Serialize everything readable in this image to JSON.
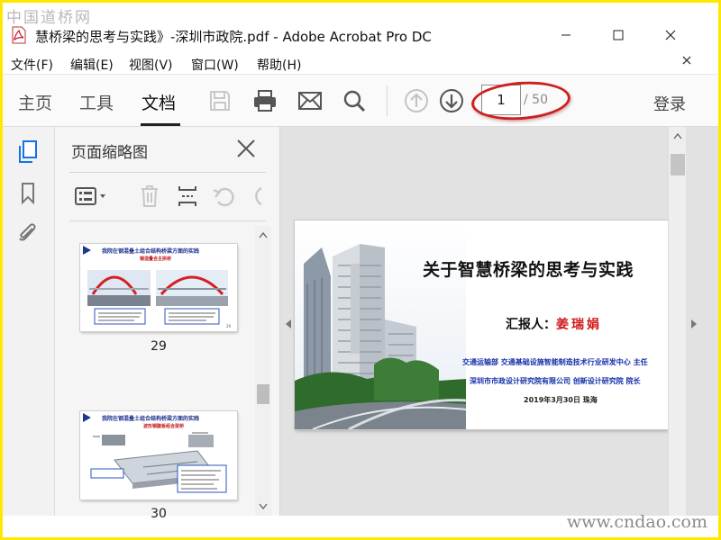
{
  "watermark": {
    "top": "中国道桥网",
    "bottom": "www.cndao.com"
  },
  "window": {
    "title": "慧桥梁的思考与实践》-深圳市政院.pdf - Adobe Acrobat Pro DC"
  },
  "menu": {
    "items": [
      "文件(F)",
      "编辑(E)",
      "视图(V)",
      "窗口(W)",
      "帮助(H)"
    ]
  },
  "toolbar": {
    "tabs": [
      "主页",
      "工具",
      "文档"
    ],
    "active_tab": "文档",
    "current_page": "1",
    "total_pages": "/ 50",
    "login": "登录",
    "icons": [
      "save-icon",
      "print-icon",
      "email-icon",
      "search-icon",
      "previous-page-icon",
      "next-page-icon"
    ]
  },
  "thumb_panel": {
    "title": "页面缩略图",
    "thumbnails": [
      {
        "page": "29",
        "title": "我院在钢混叠土组合结构桥梁方面的实践",
        "subtitle": "钢混叠合主拱桥"
      },
      {
        "page": "30",
        "title": "我院在钢混叠土组合结构桥梁方面的实践",
        "subtitle": "波形钢腹板组合梁桥"
      }
    ]
  },
  "document": {
    "slide_title": "关于智慧桥梁的思考与实践",
    "reporter_label": "汇报人：",
    "reporter_name": "姜瑞娟",
    "institution_1": "交通运输部 交通基础设施智能制造技术行业研发中心 主任",
    "institution_2": "深圳市市政设计研究院有限公司 创新设计研究院 院长",
    "date_location": "2019年3月30日 珠海"
  },
  "colors": {
    "accent_red": "#cc2020",
    "title_blue": "#1530a8",
    "active_nav": "#1473e6"
  }
}
